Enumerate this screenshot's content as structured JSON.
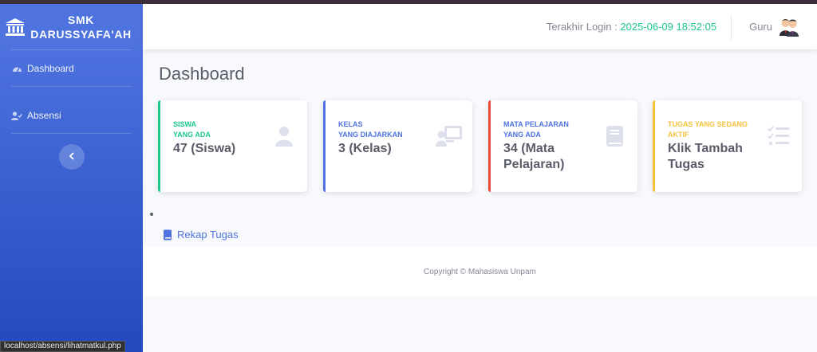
{
  "sidebar": {
    "brand": {
      "line1": "SMK",
      "line2": "DARUSSYAFA'AH",
      "icon": "institution-icon"
    },
    "items": [
      {
        "label": "Dashboard",
        "icon": "tachometer-icon"
      },
      {
        "label": "Absensi",
        "icon": "user-check-icon"
      }
    ],
    "toggle_icon": "chevron-left-icon"
  },
  "topbar": {
    "login_label": "Terakhir Login : ",
    "login_time": "2025-06-09 18:52:05",
    "user_name": "Guru",
    "avatar_icon": "user-pair-icon"
  },
  "main": {
    "title": "Dashboard",
    "cards": [
      {
        "label": "SISWA\nYANG ADA",
        "value": "47 (Siswa)",
        "color": "#1cc88a",
        "icon": "user-icon"
      },
      {
        "label": "KELAS\nYANG DIAJARKAN",
        "value": "3 (Kelas)",
        "color": "#4e73df",
        "icon": "chalkboard-teacher-icon"
      },
      {
        "label": "MATA PELAJARAN\nYANG ADA",
        "value": "34 (Mata\nPelajaran)",
        "color": "#e74a3b",
        "icon": "book-icon"
      },
      {
        "label": "TUGAS YANG SEDANG\nAKTIF",
        "value": "Klik Tambah\nTugas",
        "color": "#f6c23e",
        "icon": "tasks-icon"
      }
    ],
    "rekap_label": "Rekap Tugas",
    "rekap_icon": "book-icon"
  },
  "footer": {
    "text": "Copyright © Mahasiswa Unpam"
  },
  "status_url": "localhost/absensi/lihatmatkul.php",
  "colors": {
    "primary": "#4e73df",
    "success": "#1cc88a",
    "danger": "#e74a3b",
    "warning": "#f6c23e",
    "card_icon": "#dddfeb"
  }
}
